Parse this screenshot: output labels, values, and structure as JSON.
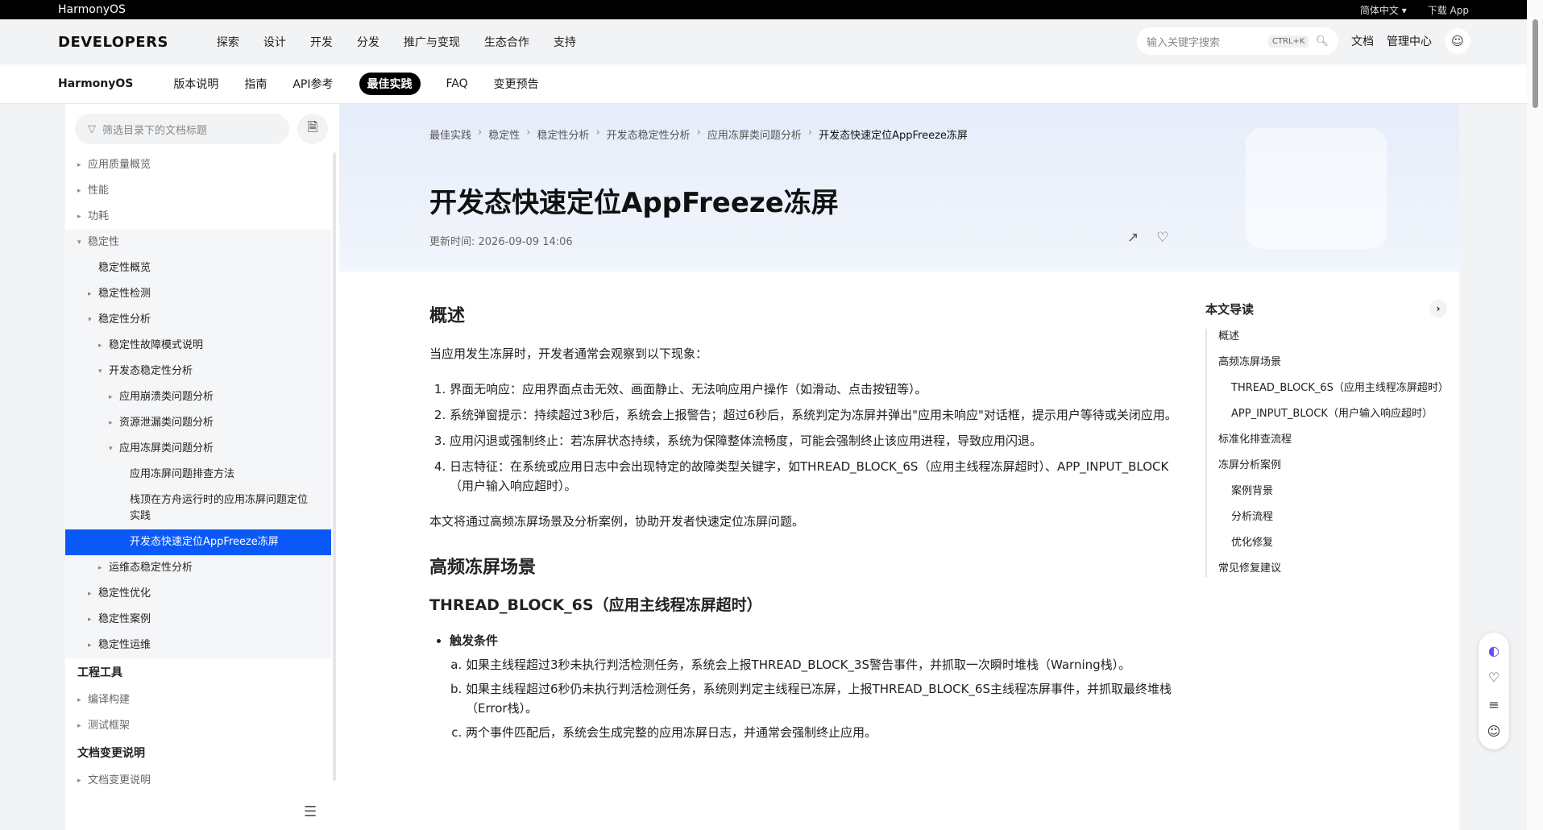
{
  "topbar": {
    "brand": "HarmonyOS",
    "lang": "简体中文 ▾",
    "download": "下载 App"
  },
  "header": {
    "logo": "DEVELOPERS",
    "nav": [
      "探索",
      "设计",
      "开发",
      "分发",
      "推广与变现",
      "生态合作",
      "支持"
    ],
    "search_placeholder": "输入关键字搜索",
    "search_shortcut": "CTRL+K",
    "docs": "文档",
    "console": "管理中心"
  },
  "subnav": {
    "brand": "HarmonyOS",
    "tabs": [
      "版本说明",
      "指南",
      "API参考",
      "最佳实践",
      "FAQ",
      "变更预告"
    ],
    "active_tab": "最佳实践"
  },
  "sidebar": {
    "filter_placeholder": "筛选目录下的文档标题",
    "items": [
      {
        "label": "应用质量概览",
        "level": 0,
        "arrow": "▸",
        "grey": true
      },
      {
        "label": "性能",
        "level": 0,
        "arrow": "▸",
        "grey": true
      },
      {
        "label": "功耗",
        "level": 0,
        "arrow": "▸",
        "grey": true
      },
      {
        "label": "稳定性",
        "level": 0,
        "arrow": "▾",
        "grey": true,
        "bg": true
      },
      {
        "label": "稳定性概览",
        "level": 1,
        "arrow": "",
        "bg": true
      },
      {
        "label": "稳定性检测",
        "level": 1,
        "arrow": "▸",
        "bg": true
      },
      {
        "label": "稳定性分析",
        "level": 1,
        "arrow": "▾",
        "bg": true
      },
      {
        "label": "稳定性故障模式说明",
        "level": 2,
        "arrow": "▸",
        "bg": true
      },
      {
        "label": "开发态稳定性分析",
        "level": 2,
        "arrow": "▾",
        "bg": true
      },
      {
        "label": "应用崩溃类问题分析",
        "level": 3,
        "arrow": "▸",
        "bg": true
      },
      {
        "label": "资源泄漏类问题分析",
        "level": 3,
        "arrow": "▸",
        "bg": true
      },
      {
        "label": "应用冻屏类问题分析",
        "level": 3,
        "arrow": "▾",
        "bg": true
      },
      {
        "label": "应用冻屏问题排查方法",
        "level": 4,
        "arrow": "",
        "bg": true
      },
      {
        "label": "栈顶在方舟运行时的应用冻屏问题定位实践",
        "level": 4,
        "arrow": "",
        "bg": true,
        "two": true
      },
      {
        "label": "开发态快速定位AppFreeze冻屏",
        "level": 4,
        "arrow": "",
        "active": true
      },
      {
        "label": "运维态稳定性分析",
        "level": 2,
        "arrow": "▸",
        "bg": true
      },
      {
        "label": "稳定性优化",
        "level": 1,
        "arrow": "▸",
        "bg": true
      },
      {
        "label": "稳定性案例",
        "level": 1,
        "arrow": "▸",
        "bg": true
      },
      {
        "label": "稳定性运维",
        "level": 1,
        "arrow": "▸",
        "bg": true
      }
    ],
    "section1": "工程工具",
    "section1_items": [
      "编译构建",
      "测试框架"
    ],
    "section2": "文档变更说明",
    "section2_items": [
      "文档变更说明"
    ]
  },
  "breadcrumb": [
    "最佳实践",
    "稳定性",
    "稳定性分析",
    "开发态稳定性分析",
    "应用冻屏类问题分析",
    "开发态快速定位AppFreeze冻屏"
  ],
  "article": {
    "title": "开发态快速定位AppFreeze冻屏",
    "updated": "更新时间: 2026-09-09 14:06",
    "h_overview": "概述",
    "intro": "当应用发生冻屏时，开发者通常会观察到以下现象：",
    "symptoms": [
      "界面无响应：应用界面点击无效、画面静止、无法响应用户操作（如滑动、点击按钮等）。",
      "系统弹窗提示：持续超过3秒后，系统会上报警告；超过6秒后，系统判定为冻屏并弹出\"应用未响应\"对话框，提示用户等待或关闭应用。",
      "应用闪退或强制终止：若冻屏状态持续，系统为保障整体流畅度，可能会强制终止该应用进程，导致应用闪退。",
      "日志特征：在系统或应用日志中会出现特定的故障类型关键字，如THREAD_BLOCK_6S（应用主线程冻屏超时）、APP_INPUT_BLOCK（用户输入响应超时）。"
    ],
    "summary": "本文将通过高频冻屏场景及分析案例，协助开发者快速定位冻屏问题。",
    "h_scenes": "高频冻屏场景",
    "h_thread": "THREAD_BLOCK_6S（应用主线程冻屏超时）",
    "trigger_label": "触发条件",
    "trigger_items": [
      "如果主线程超过3秒未执行判活检测任务，系统会上报THREAD_BLOCK_3S警告事件，并抓取一次瞬时堆栈（Warning栈）。",
      "如果主线程超过6秒仍未执行判活检测任务，系统则判定主线程已冻屏，上报THREAD_BLOCK_6S主线程冻屏事件，并抓取最终堆栈（Error栈）。",
      "两个事件匹配后，系统会生成完整的应用冻屏日志，并通常会强制终止应用。"
    ]
  },
  "toc": {
    "title": "本文导读",
    "items": [
      {
        "label": "概述",
        "sub": false
      },
      {
        "label": "高频冻屏场景",
        "sub": false
      },
      {
        "label": "THREAD_BLOCK_6S（应用主线程冻屏超时）",
        "sub": true
      },
      {
        "label": "APP_INPUT_BLOCK（用户输入响应超时）",
        "sub": true
      },
      {
        "label": "标准化排查流程",
        "sub": false
      },
      {
        "label": "冻屏分析案例",
        "sub": false
      },
      {
        "label": "案例背景",
        "sub": true
      },
      {
        "label": "分析流程",
        "sub": true
      },
      {
        "label": "优化修复",
        "sub": true
      },
      {
        "label": "常见修复建议",
        "sub": false
      }
    ]
  },
  "icons": {
    "search": "search-icon",
    "user": "user-icon",
    "filter": "filter-icon",
    "doc": "document-icon",
    "collapse": "collapse-sidebar-icon",
    "share": "share-icon",
    "favorite": "heart-icon",
    "chevron": "chevron-right-icon",
    "ai": "ai-assistant-icon",
    "feedback": "feedback-icon",
    "layers": "layers-icon",
    "smile": "smile-icon"
  },
  "colors": {
    "accent": "#0a59f7",
    "topbar": "#000000",
    "active_tab_bg": "#000000"
  }
}
